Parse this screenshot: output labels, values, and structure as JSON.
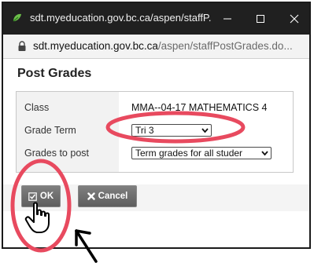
{
  "window": {
    "title": "sdt.myeducation.gov.bc.ca/aspen/staffP...",
    "url_host": "sdt.myeducation.gov.bc.ca",
    "url_path": "/aspen/staffPostGrades.do..."
  },
  "dialog": {
    "title": "Post Grades",
    "fields": {
      "class_label": "Class",
      "class_value": "MMA--04-17  MATHEMATICS 4",
      "grade_term_label": "Grade Term",
      "grade_term_value": "Tri 3",
      "grades_to_post_label": "Grades to post",
      "grades_to_post_value": "Term grades for all studer"
    },
    "buttons": {
      "ok_label": "OK",
      "cancel_label": "Cancel"
    }
  },
  "icons": [
    "favicon-icon",
    "minimize-icon",
    "maximize-icon",
    "close-icon",
    "lock-icon",
    "check-icon",
    "x-icon",
    "chevron-down-icon",
    "hand-cursor-icon",
    "arrow-annotation-icon"
  ],
  "colors": {
    "titlebar": "#202020",
    "annotation_red": "#e84a5f",
    "button_gray": "#6e6e6e"
  }
}
